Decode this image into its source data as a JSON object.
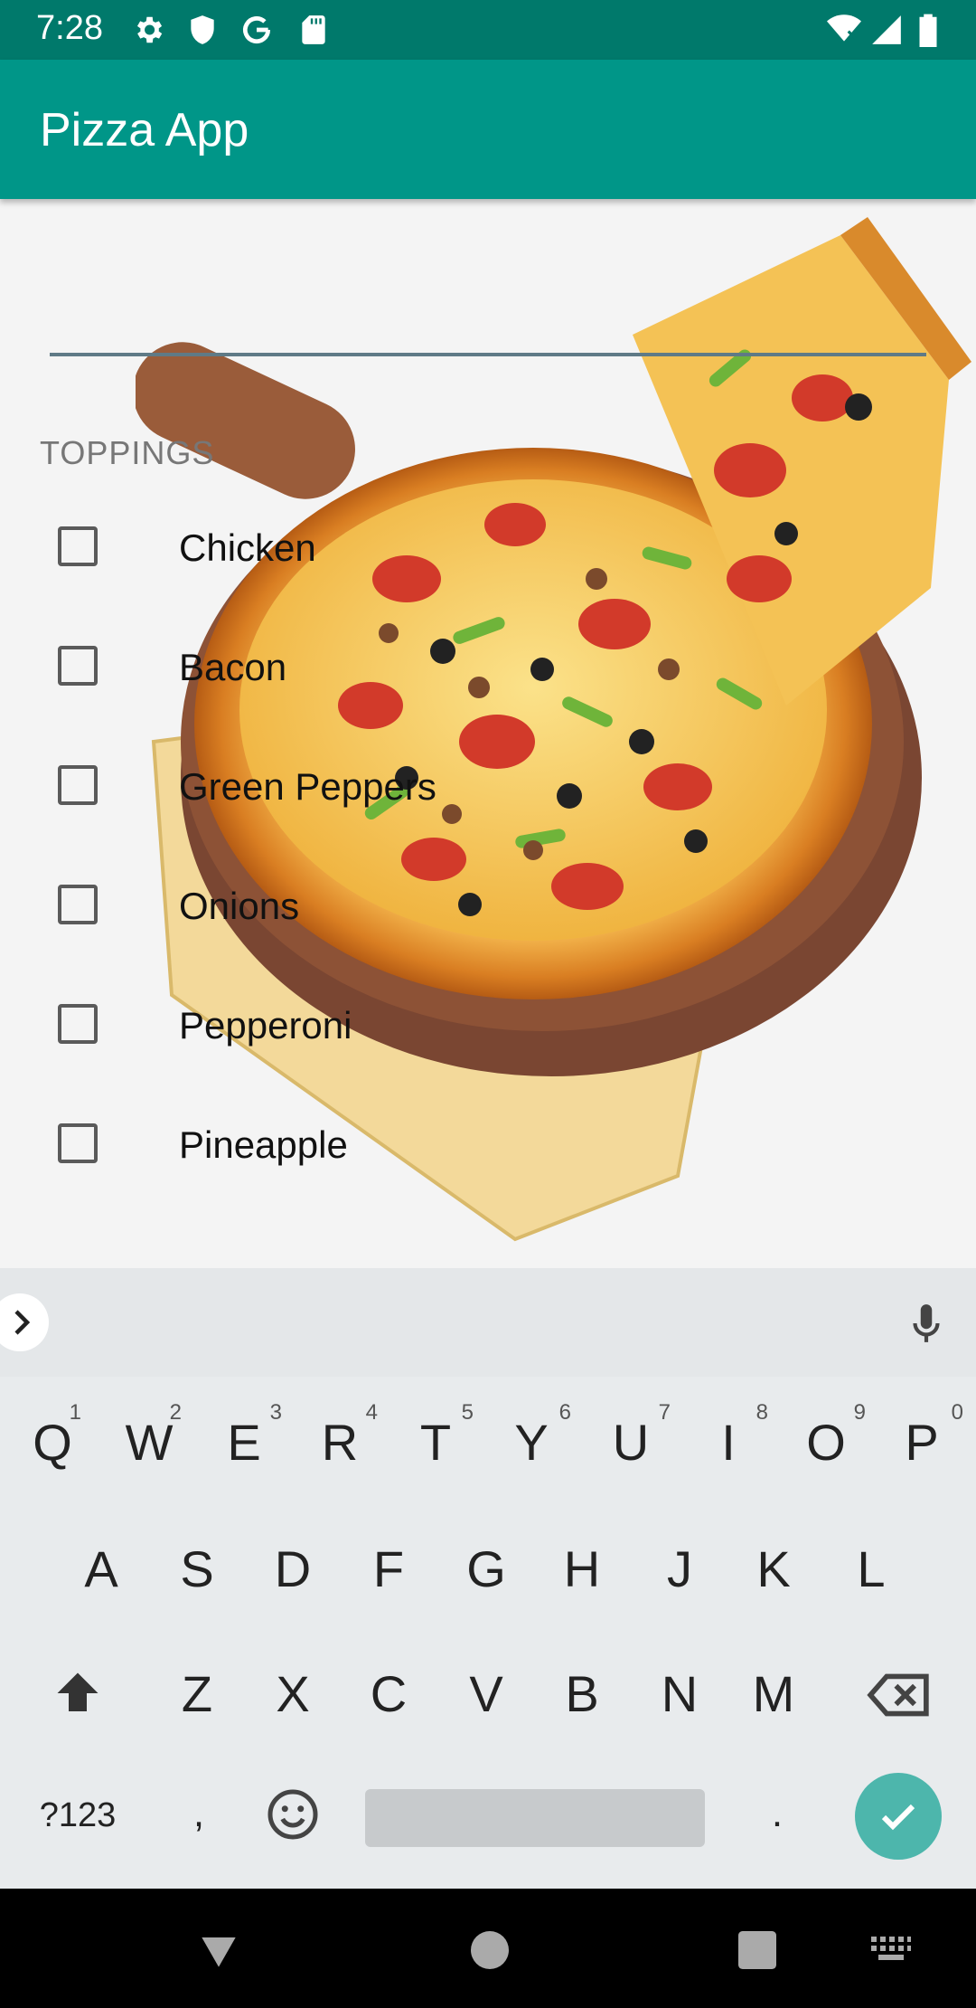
{
  "status_bar": {
    "time": "7:28"
  },
  "app_bar": {
    "title": "Pizza App"
  },
  "form": {
    "name_field": {
      "value": "",
      "placeholder": ""
    },
    "section_label": "TOPPINGS",
    "toppings": [
      {
        "label": "Chicken",
        "checked": false
      },
      {
        "label": "Bacon",
        "checked": false
      },
      {
        "label": "Green Peppers",
        "checked": false
      },
      {
        "label": "Onions",
        "checked": false
      },
      {
        "label": "Pepperoni",
        "checked": false
      },
      {
        "label": "Pineapple",
        "checked": false
      }
    ]
  },
  "keyboard": {
    "row1": [
      {
        "key": "Q",
        "num": "1"
      },
      {
        "key": "W",
        "num": "2"
      },
      {
        "key": "E",
        "num": "3"
      },
      {
        "key": "R",
        "num": "4"
      },
      {
        "key": "T",
        "num": "5"
      },
      {
        "key": "Y",
        "num": "6"
      },
      {
        "key": "U",
        "num": "7"
      },
      {
        "key": "I",
        "num": "8"
      },
      {
        "key": "O",
        "num": "9"
      },
      {
        "key": "P",
        "num": "0"
      }
    ],
    "row2": [
      "A",
      "S",
      "D",
      "F",
      "G",
      "H",
      "J",
      "K",
      "L"
    ],
    "row3": [
      "Z",
      "X",
      "C",
      "V",
      "B",
      "N",
      "M"
    ],
    "symbols_key": "?123",
    "comma_key": ",",
    "period_key": "."
  },
  "colors": {
    "status_bar": "#00796b",
    "app_bar": "#009688",
    "enter_key": "#4db6ac"
  }
}
